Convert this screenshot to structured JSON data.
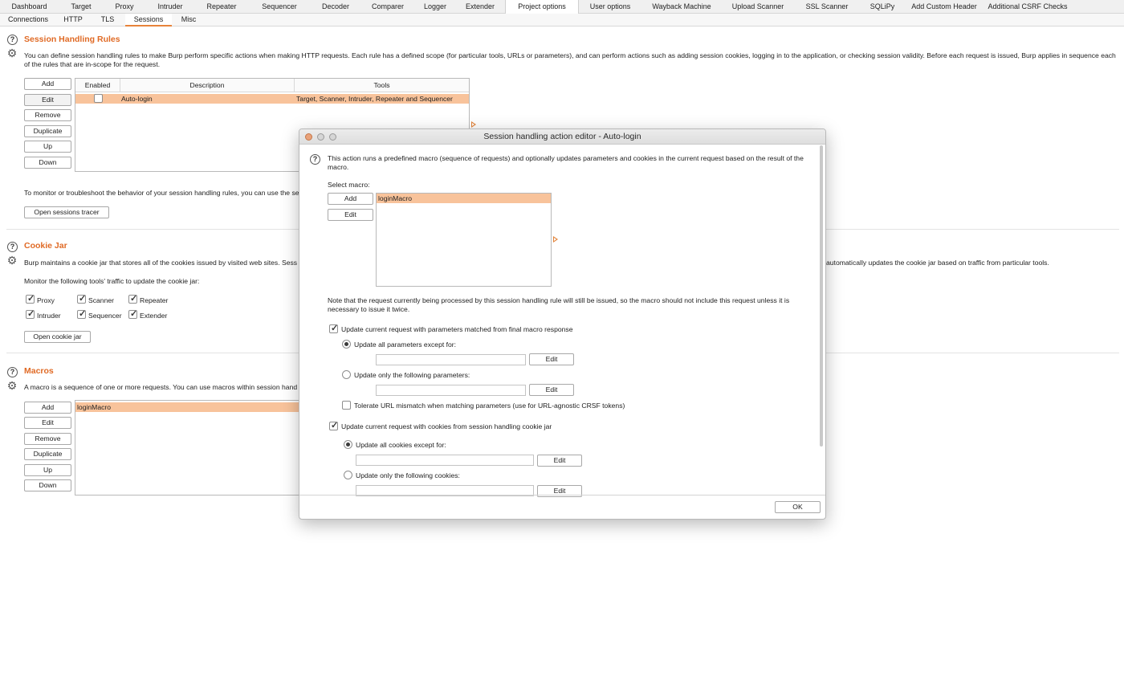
{
  "top_tabs": [
    "Dashboard",
    "Target",
    "Proxy",
    "Intruder",
    "Repeater",
    "Sequencer",
    "Decoder",
    "Comparer",
    "Logger",
    "Extender",
    "Project options",
    "User options",
    "Wayback Machine",
    "Upload Scanner",
    "SSL Scanner",
    "SQLiPy",
    "Add Custom Header",
    "Additional CSRF Checks"
  ],
  "active_top_tab": "Project options",
  "sub_tabs": [
    "Connections",
    "HTTP",
    "TLS",
    "Sessions",
    "Misc"
  ],
  "active_sub_tab": "Sessions",
  "session_rules": {
    "title": "Session Handling Rules",
    "desc": "You can define session handling rules to make Burp perform specific actions when making HTTP requests. Each rule has a defined scope (for particular tools, URLs or parameters), and can perform actions such as adding session cookies, logging in to the application, or checking session validity. Before each request is issued, Burp applies in sequence each of the rules that are in-scope for the request.",
    "buttons": [
      "Add",
      "Edit",
      "Remove",
      "Duplicate",
      "Up",
      "Down"
    ],
    "columns": [
      "Enabled",
      "Description",
      "Tools"
    ],
    "rows": [
      {
        "enabled": false,
        "description": "Auto-login",
        "tools": "Target, Scanner, Intruder, Repeater and Sequencer"
      }
    ],
    "monitor_text": "To monitor or troubleshoot the behavior of your session handling rules, you can use the se",
    "tracer_button": "Open sessions tracer"
  },
  "cookie_jar": {
    "title": "Cookie Jar",
    "desc_left": "Burp maintains a cookie jar that stores all of the cookies issued by visited web sites. Sess",
    "desc_right": "automatically updates the cookie jar based on traffic from particular tools.",
    "monitor_label": "Monitor the following tools' traffic to update the cookie jar:",
    "tools": [
      {
        "label": "Proxy",
        "checked": true
      },
      {
        "label": "Scanner",
        "checked": true
      },
      {
        "label": "Repeater",
        "checked": true
      },
      {
        "label": "Intruder",
        "checked": true
      },
      {
        "label": "Sequencer",
        "checked": true
      },
      {
        "label": "Extender",
        "checked": true
      }
    ],
    "open_button": "Open cookie jar"
  },
  "macros": {
    "title": "Macros",
    "desc": "A macro is a sequence of one or more requests. You can use macros within session hand",
    "buttons": [
      "Add",
      "Edit",
      "Remove",
      "Duplicate",
      "Up",
      "Down"
    ],
    "items": [
      "loginMacro"
    ]
  },
  "dialog": {
    "title": "Session handling action editor - Auto-login",
    "intro": "This action runs a predefined macro (sequence of requests) and optionally updates parameters and cookies in the current request based on the result of the macro.",
    "select_macro_label": "Select macro:",
    "macro_buttons": [
      "Add",
      "Edit"
    ],
    "macros": [
      "loginMacro"
    ],
    "note": "Note that the request currently being processed by this session handling rule will still be issued, so the macro should not include this request unless it is necessary to issue it twice.",
    "update_params_label": "Update current request with parameters matched from final macro response",
    "update_params_checked": true,
    "params_all_except": "Update all parameters except for:",
    "params_only": "Update only the following parameters:",
    "tolerate_label": "Tolerate URL mismatch when matching parameters (use for URL-agnostic CRSF tokens)",
    "tolerate_checked": false,
    "update_cookies_label": "Update current request with cookies from session handling cookie jar",
    "update_cookies_checked": true,
    "cookies_all_except": "Update all cookies except for:",
    "cookies_only": "Update only the following cookies:",
    "edit_label": "Edit",
    "ok_label": "OK"
  },
  "colors": {
    "accent": "#e06a25",
    "selection": "#f8c39b"
  }
}
